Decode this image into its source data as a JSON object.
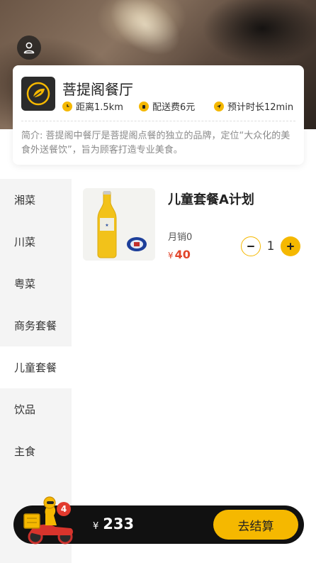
{
  "shop": {
    "name": "菩提阁餐厅",
    "distance": "距离1.5km",
    "delivery_fee": "配送费6元",
    "eta": "预计时长12min",
    "intro": "简介: 菩提阁中餐厅是菩提阁点餐的独立的品牌，定位“大众化的美食外送餐饮”，旨为顾客打造专业美食。"
  },
  "categories": [
    {
      "label": "湘菜",
      "active": false
    },
    {
      "label": "川菜",
      "active": false
    },
    {
      "label": "粤菜",
      "active": false
    },
    {
      "label": "商务套餐",
      "active": false
    },
    {
      "label": "儿童套餐",
      "active": true
    },
    {
      "label": "饮品",
      "active": false
    },
    {
      "label": "主食",
      "active": false
    }
  ],
  "product": {
    "title": "儿童套餐A计划",
    "sales": "月销0",
    "price_symbol": "¥",
    "price": "40",
    "quantity": "1"
  },
  "cart": {
    "badge": "4",
    "currency": "¥",
    "total": "233",
    "checkout_label": "去结算"
  },
  "colors": {
    "accent": "#f5b800",
    "price": "#e2462b",
    "cart_bar": "#111111",
    "badge": "#e23a2e"
  }
}
